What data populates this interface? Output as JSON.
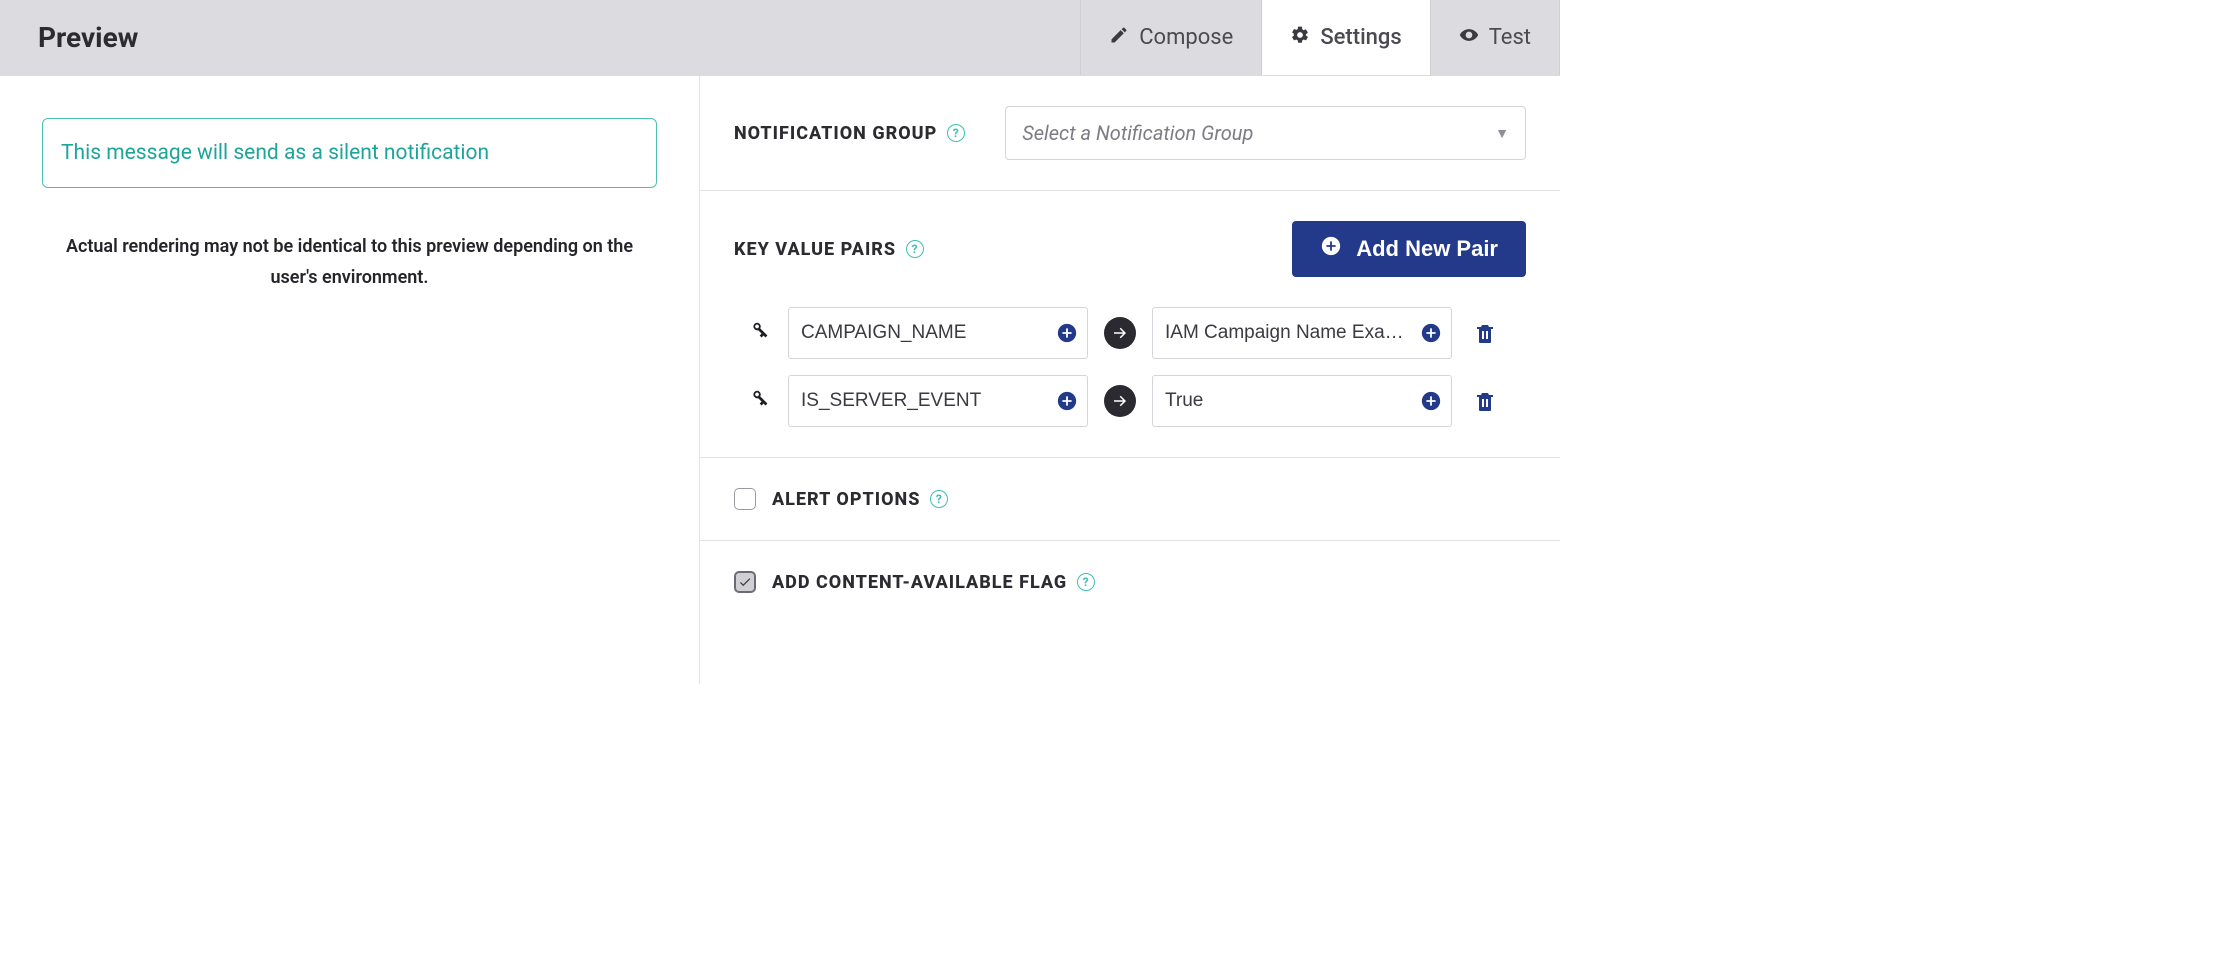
{
  "topbar": {
    "title": "Preview",
    "tabs": [
      {
        "label": "Compose",
        "active": false
      },
      {
        "label": "Settings",
        "active": true
      },
      {
        "label": "Test",
        "active": false
      }
    ]
  },
  "preview": {
    "silent_message": "This message will send as a silent notification",
    "disclaimer": "Actual rendering may not be identical to this preview depending on the user's environment."
  },
  "settings": {
    "notification_group": {
      "label": "NOTIFICATION GROUP",
      "placeholder": "Select a Notification Group"
    },
    "kvp": {
      "label": "KEY VALUE PAIRS",
      "add_button": "Add New Pair",
      "rows": [
        {
          "key": "CAMPAIGN_NAME",
          "value": "IAM Campaign Name Example"
        },
        {
          "key": "IS_SERVER_EVENT",
          "value": "True"
        }
      ]
    },
    "alert_options": {
      "label": "ALERT OPTIONS",
      "checked": false
    },
    "content_available": {
      "label": "ADD CONTENT-AVAILABLE FLAG",
      "checked": true
    }
  }
}
